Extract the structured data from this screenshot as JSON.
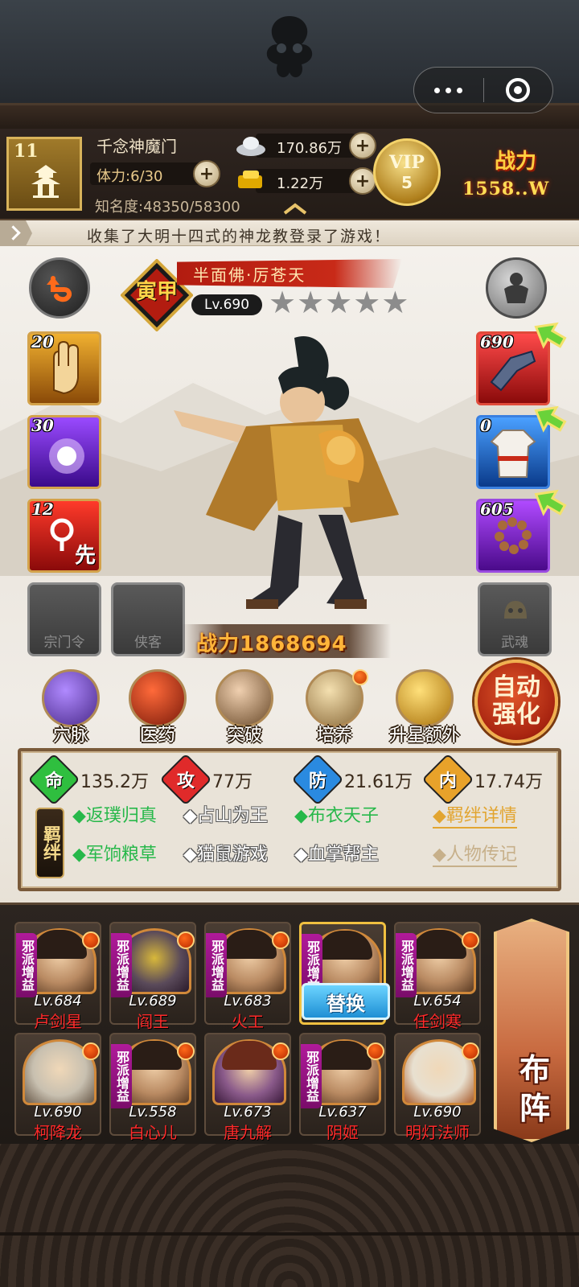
{
  "header": {
    "sect_level": "11",
    "sect_name": "千念神魔门",
    "stamina": "体力:6/30",
    "fame": "知名度:48350/58300",
    "silver": "170.86万",
    "gold": "1.22万",
    "vip_label": "VIP",
    "vip_level": "5",
    "power_label": "战力",
    "power_value": "1558..W"
  },
  "marquee": {
    "text": "收集了大明十四式的神龙教登录了游戏！"
  },
  "character": {
    "badge": "寅甲",
    "name": "半面佛·厉苍天",
    "level": "Lv.690",
    "stars_total": 5,
    "stars_filled": 0,
    "power": "战力1868694"
  },
  "skills": [
    {
      "count": "20",
      "icon": "palm-icon"
    },
    {
      "count": "30",
      "icon": "purple-fist-icon"
    },
    {
      "count": "12",
      "icon": "first-strike-icon",
      "mark": "先"
    }
  ],
  "equipment": [
    {
      "count": "690",
      "icon": "gauntlet-icon"
    },
    {
      "count": "0",
      "icon": "white-robe-icon"
    },
    {
      "count": "605",
      "icon": "prayer-beads-icon"
    }
  ],
  "slots": {
    "sect_token": "宗门令",
    "retainer": "侠客",
    "martial_soul": "武魂"
  },
  "functions": [
    {
      "label": "穴脉",
      "dot": false
    },
    {
      "label": "医药",
      "dot": false
    },
    {
      "label": "突破",
      "dot": false
    },
    {
      "label": "培养",
      "dot": true
    },
    {
      "label": "升星额外",
      "dot": false
    }
  ],
  "auto_strengthen": "自动强化",
  "stats": {
    "life_label": "命",
    "life": "135.2万",
    "atk_label": "攻",
    "atk": "77万",
    "def_label": "防",
    "def": "21.61万",
    "inner_label": "内",
    "inner": "17.74万"
  },
  "bonds": {
    "tag": "羁绊",
    "items": [
      {
        "text": "◆返璞归真",
        "active": true
      },
      {
        "text": "◆占山为王",
        "active": false
      },
      {
        "text": "◆布衣天子",
        "active": true
      },
      {
        "text": "◆军饷粮草",
        "active": true
      },
      {
        "text": "◆猫鼠游戏",
        "active": false
      },
      {
        "text": "◆血掌帮主",
        "active": false
      }
    ],
    "details_link": "◆羁绊详情",
    "bio_link": "◆人物传记"
  },
  "roster": [
    {
      "level": "Lv.684",
      "name": "卢剑星",
      "tag": "邪派增益"
    },
    {
      "level": "Lv.689",
      "name": "阎王",
      "tag": "邪派增益"
    },
    {
      "level": "Lv.683",
      "name": "火工",
      "tag": "邪派增益"
    },
    {
      "level": "",
      "name": "",
      "tag": "邪派增益",
      "selected": true
    },
    {
      "level": "Lv.654",
      "name": "任剑寒",
      "tag": "邪派增益"
    },
    {
      "level": "Lv.690",
      "name": "柯降龙",
      "tag": ""
    },
    {
      "level": "Lv.558",
      "name": "白心儿",
      "tag": "邪派增益"
    },
    {
      "level": "Lv.673",
      "name": "唐九解",
      "tag": ""
    },
    {
      "level": "Lv.637",
      "name": "阴姬",
      "tag": "邪派增益"
    },
    {
      "level": "Lv.690",
      "name": "明灯法师",
      "tag": ""
    }
  ],
  "swap_label": "替换",
  "deploy_label": "布阵",
  "colors": {
    "accent_red": "#b21c10",
    "gold": "#d3a24a",
    "bond_green": "#27b84a",
    "tag_purple": "#b01a9a",
    "swap_blue": "#1e8fd4"
  }
}
